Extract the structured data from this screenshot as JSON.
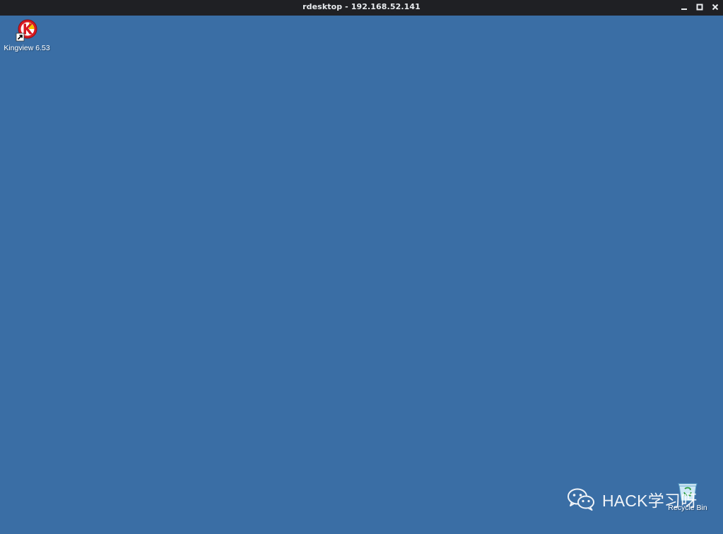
{
  "window": {
    "title": "rdesktop - 192.168.52.141",
    "controls": {
      "minimize_icon": "minimize-icon",
      "maximize_icon": "maximize-icon",
      "close_icon": "close-icon"
    }
  },
  "desktop": {
    "background_color": "#3a6ea5",
    "icons": [
      {
        "label": "Kingview 6.53",
        "icon": "kingview-app-icon",
        "shortcut": true
      },
      {
        "label": "Recycle Bin",
        "icon": "recycle-bin-icon",
        "shortcut": false
      }
    ]
  },
  "watermark": {
    "text": "HACK学习呀",
    "icon": "wechat-icon"
  }
}
